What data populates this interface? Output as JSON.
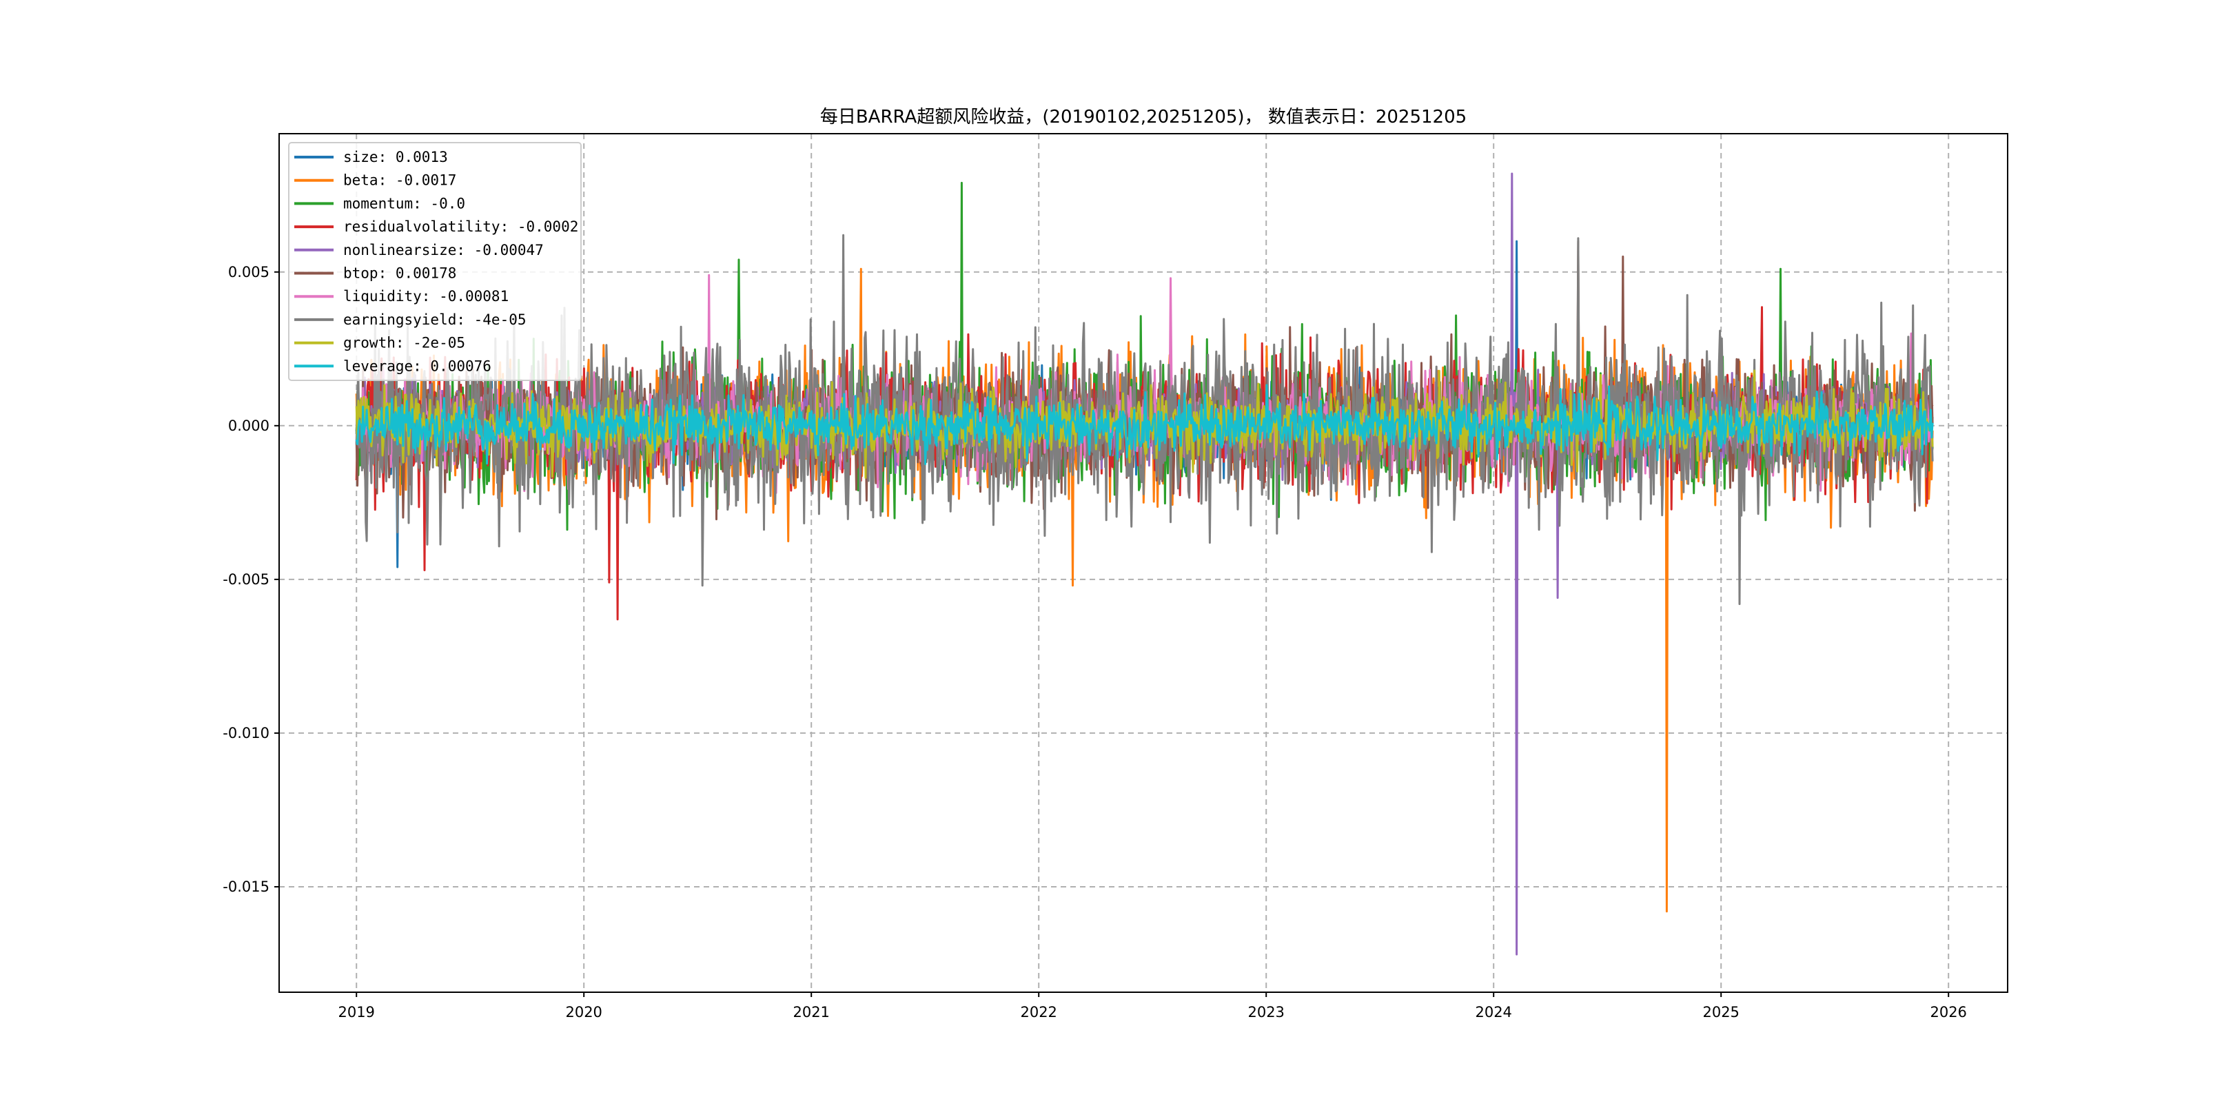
{
  "chart_data": {
    "type": "line",
    "title": "每日BARRA超额风险收益，(20190102,20251205)， 数值表示日：20251205",
    "xlabel": "",
    "ylabel": "",
    "xlim": [
      2018.66,
      2026.26
    ],
    "ylim": [
      -0.01843,
      0.0095
    ],
    "xticks": [
      2019,
      2020,
      2021,
      2022,
      2023,
      2024,
      2025,
      2026
    ],
    "xtick_labels": [
      "2019",
      "2020",
      "2021",
      "2022",
      "2023",
      "2024",
      "2025",
      "2026"
    ],
    "yticks": [
      0.005,
      0.0,
      -0.005,
      -0.01,
      -0.015
    ],
    "ytick_labels": [
      "0.005",
      "0.000",
      "-0.005",
      "-0.010",
      "-0.015"
    ],
    "grid": true,
    "legend_placement": "upper-left",
    "x_range": [
      2019.0,
      2025.93
    ],
    "series": [
      {
        "name": "size",
        "legend": "size: 0.0013",
        "color": "#1f77b4",
        "typical_abs": 0.0006,
        "extremes": [
          {
            "x": 2019.18,
            "y": -0.0046
          },
          {
            "x": 2024.1,
            "y": 0.006
          }
        ]
      },
      {
        "name": "beta",
        "legend": "beta: -0.0017",
        "color": "#ff7f0e",
        "typical_abs": 0.001,
        "extremes": [
          {
            "x": 2024.76,
            "y": -0.0158
          },
          {
            "x": 2021.22,
            "y": 0.0051
          },
          {
            "x": 2022.15,
            "y": -0.0052
          }
        ]
      },
      {
        "name": "momentum",
        "legend": "momentum: -0.0",
        "color": "#2ca02c",
        "typical_abs": 0.001,
        "extremes": [
          {
            "x": 2021.66,
            "y": 0.0079
          },
          {
            "x": 2020.68,
            "y": 0.0054
          },
          {
            "x": 2025.26,
            "y": 0.0051
          }
        ]
      },
      {
        "name": "residualvolatility",
        "legend": "residualvolatility: -0.0002",
        "color": "#d62728",
        "typical_abs": 0.0009,
        "extremes": [
          {
            "x": 2020.15,
            "y": -0.0063
          },
          {
            "x": 2020.11,
            "y": -0.0051
          },
          {
            "x": 2019.3,
            "y": -0.0047
          }
        ]
      },
      {
        "name": "nonlinearsize",
        "legend": "nonlinearsize: -0.00047",
        "color": "#9467bd",
        "typical_abs": 0.0006,
        "extremes": [
          {
            "x": 2024.08,
            "y": 0.0082
          },
          {
            "x": 2024.1,
            "y": -0.0172
          },
          {
            "x": 2024.28,
            "y": -0.0056
          }
        ]
      },
      {
        "name": "btop",
        "legend": "btop: 0.00178",
        "color": "#8c564b",
        "typical_abs": 0.0009,
        "extremes": [
          {
            "x": 2024.57,
            "y": 0.0055
          },
          {
            "x": 2024.37,
            "y": 0.006
          }
        ]
      },
      {
        "name": "liquidity",
        "legend": "liquidity: -0.00081",
        "color": "#e377c2",
        "typical_abs": 0.0007,
        "extremes": [
          {
            "x": 2020.55,
            "y": 0.0049
          },
          {
            "x": 2022.58,
            "y": 0.0048
          }
        ]
      },
      {
        "name": "earningsyield",
        "legend": "earningsyield: -4e-05",
        "color": "#7f7f7f",
        "typical_abs": 0.0014,
        "extremes": [
          {
            "x": 2021.14,
            "y": 0.0062
          },
          {
            "x": 2024.37,
            "y": 0.0061
          },
          {
            "x": 2025.08,
            "y": -0.0058
          },
          {
            "x": 2020.52,
            "y": -0.0052
          }
        ]
      },
      {
        "name": "growth",
        "legend": "growth: -2e-05",
        "color": "#bcbd22",
        "typical_abs": 0.0005,
        "extremes": []
      },
      {
        "name": "leverage",
        "legend": "leverage: 0.00076",
        "color": "#17becf",
        "typical_abs": 0.0004,
        "extremes": []
      }
    ]
  }
}
